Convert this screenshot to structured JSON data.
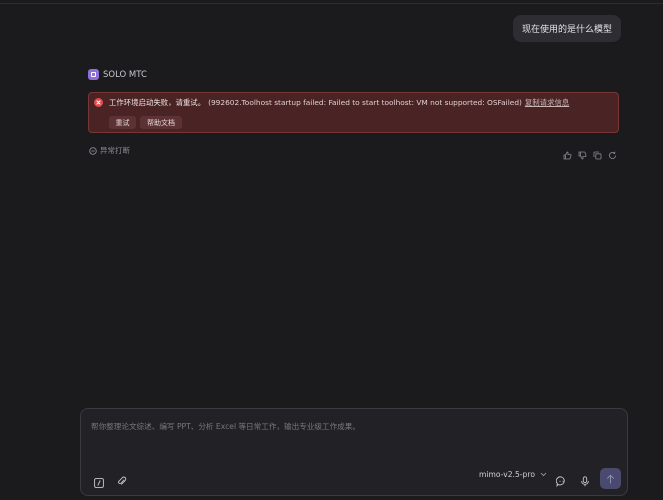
{
  "conversation": {
    "user_message": "现在使用的是什么模型",
    "agent": {
      "name": "SOLO MTC",
      "logo_color": "#8f6fd9"
    },
    "error": {
      "message": "工作环境启动失败，请重试。",
      "detail": "(992602.Toolhost startup failed: Failed to start toolhost: VM not supported: OSFailed)",
      "copy_link": "复制请求信息",
      "retry_label": "重试",
      "help_label": "帮助文档",
      "accent_color": "#e54b4b"
    },
    "interrupt_label": "异常打断"
  },
  "composer": {
    "placeholder": "帮你整理论文综述、编写 PPT、分析 Excel 等日常工作，输出专业级工作成果。",
    "model": "mimo-v2.5-pro"
  }
}
